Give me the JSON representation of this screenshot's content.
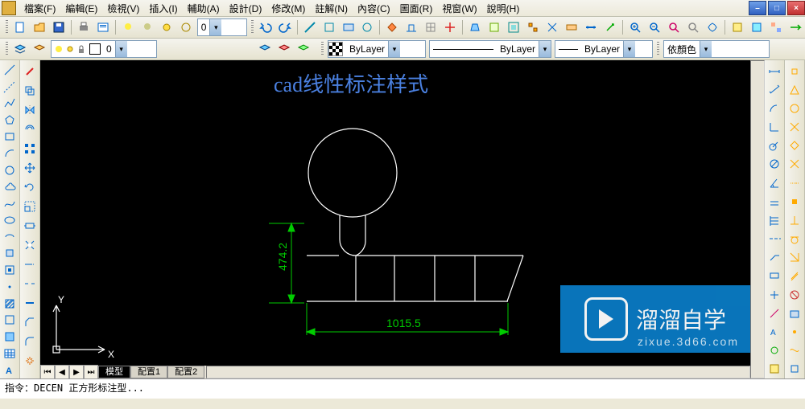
{
  "menu": {
    "items": [
      "檔案(F)",
      "編輯(E)",
      "檢視(V)",
      "插入(I)",
      "輔助(A)",
      "設計(D)",
      "修改(M)",
      "註解(N)",
      "內容(C)",
      "圖面(R)",
      "視窗(W)",
      "說明(H)"
    ]
  },
  "toolbar2": {
    "layer_state": "",
    "layer_name": "0"
  },
  "props": {
    "color_label": "ByLayer",
    "linetype_label": "ByLayer",
    "lineweight_label": "ByLayer",
    "style_label": "依顏色"
  },
  "canvas": {
    "title": "cad线性标注样式",
    "dim_v": "474.2",
    "dim_h": "1015.5",
    "axis_x": "X",
    "axis_y": "Y"
  },
  "tabs": {
    "model": "模型",
    "layout1": "配置1",
    "layout2": "配置2"
  },
  "cmd": {
    "text": "指令：DECEN  正方形标注型..."
  },
  "watermark": {
    "brand": "溜溜自学",
    "url": "zixue.3d66.com"
  }
}
